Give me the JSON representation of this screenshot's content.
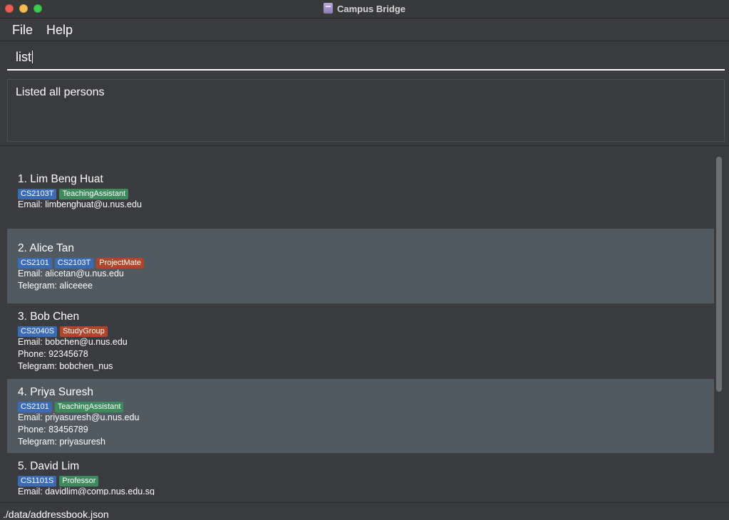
{
  "window": {
    "title": "Campus Bridge"
  },
  "menu": {
    "file": "File",
    "help": "Help"
  },
  "command": {
    "value": "list"
  },
  "result": {
    "text": "Listed all persons"
  },
  "persons": [
    {
      "name": "1. Lim Beng Huat",
      "tags": [
        {
          "label": "CS2103T",
          "kind": "mod"
        },
        {
          "label": "TeachingAssistant",
          "kind": "green"
        }
      ],
      "fields": [
        "Email: limbenghuat@u.nus.edu"
      ]
    },
    {
      "name": "2. Alice Tan",
      "tags": [
        {
          "label": "CS2101",
          "kind": "mod"
        },
        {
          "label": "CS2103T",
          "kind": "mod"
        },
        {
          "label": "ProjectMate",
          "kind": "red"
        }
      ],
      "fields": [
        "Email: alicetan@u.nus.edu",
        "Telegram: aliceeee"
      ]
    },
    {
      "name": "3. Bob Chen",
      "tags": [
        {
          "label": "CS2040S",
          "kind": "mod"
        },
        {
          "label": "StudyGroup",
          "kind": "red"
        }
      ],
      "fields": [
        "Email: bobchen@u.nus.edu",
        "Phone: 92345678",
        "Telegram: bobchen_nus"
      ]
    },
    {
      "name": "4. Priya Suresh",
      "tags": [
        {
          "label": "CS2101",
          "kind": "mod"
        },
        {
          "label": "TeachingAssistant",
          "kind": "green"
        }
      ],
      "fields": [
        "Email: priyasuresh@u.nus.edu",
        "Phone: 83456789",
        "Telegram: priyasuresh"
      ]
    },
    {
      "name": "5. David Lim",
      "tags": [
        {
          "label": "CS1101S",
          "kind": "mod"
        },
        {
          "label": "Professor",
          "kind": "green"
        }
      ],
      "fields": [
        "Email: davidlim@comp.nus.edu.sg"
      ]
    }
  ],
  "status": {
    "path": "./data/addressbook.json"
  }
}
